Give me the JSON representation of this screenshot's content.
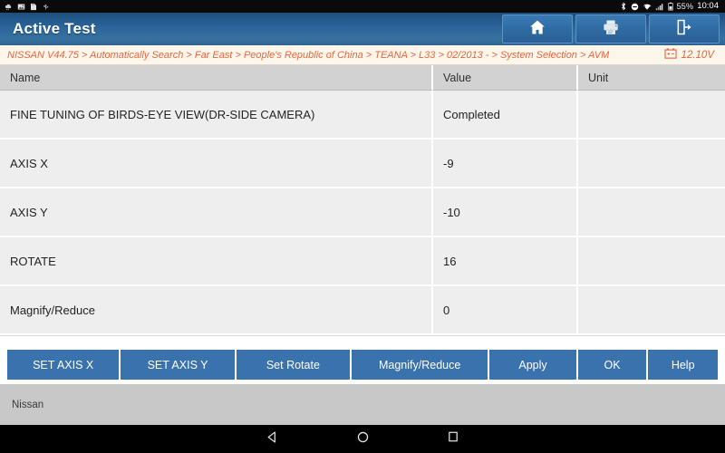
{
  "status_bar": {
    "left_icons": [
      "weather-icon",
      "image-icon",
      "sdcard-icon",
      "usb-icon"
    ],
    "right_icons": [
      "bluetooth-icon",
      "do-not-disturb-icon",
      "wifi-icon",
      "signal-icon",
      "battery-icon"
    ],
    "battery_percent": "55%",
    "time": "10:04"
  },
  "header": {
    "title": "Active Test",
    "actions": [
      {
        "name": "home-button",
        "icon": "home-icon"
      },
      {
        "name": "print-button",
        "icon": "printer-icon"
      },
      {
        "name": "exit-button",
        "icon": "exit-door-icon"
      }
    ]
  },
  "breadcrumb": {
    "path": "NISSAN V44.75 > Automatically Search > Far East > People's Republic of China > TEANA > L33 > 02/2013 - > System Selection > AVM",
    "voltage": "12.10V",
    "voltage_icon": "car-battery-icon"
  },
  "table": {
    "columns": [
      "Name",
      "Value",
      "Unit"
    ],
    "rows": [
      {
        "name": "FINE TUNING OF BIRDS-EYE VIEW(DR-SIDE CAMERA)",
        "value": "Completed",
        "unit": ""
      },
      {
        "name": "AXIS X",
        "value": "-9",
        "unit": ""
      },
      {
        "name": "AXIS Y",
        "value": "-10",
        "unit": ""
      },
      {
        "name": "ROTATE",
        "value": "16",
        "unit": ""
      },
      {
        "name": "Magnify/Reduce",
        "value": "0",
        "unit": ""
      }
    ]
  },
  "action_buttons": [
    {
      "label": "SET AXIS X",
      "name": "set-axis-x-button"
    },
    {
      "label": "SET AXIS Y",
      "name": "set-axis-y-button"
    },
    {
      "label": "Set Rotate",
      "name": "set-rotate-button"
    },
    {
      "label": "Magnify/Reduce",
      "name": "magnify-reduce-button"
    },
    {
      "label": "Apply",
      "name": "apply-button"
    },
    {
      "label": "OK",
      "name": "ok-button"
    },
    {
      "label": "Help",
      "name": "help-button"
    }
  ],
  "footer": {
    "text": "Nissan"
  },
  "nav_bar": {
    "back": "back-triangle-icon",
    "home": "home-circle-icon",
    "recents": "recents-square-icon"
  },
  "colors": {
    "title_blue": "#2b659b",
    "button_blue": "#3a72ad",
    "breadcrumb_bg": "#fdf6ea",
    "breadcrumb_text": "#e8653c",
    "row_bg": "#eeeeee",
    "header_row_bg": "#d2d2d2",
    "footer_bg": "#c8c8c8"
  }
}
